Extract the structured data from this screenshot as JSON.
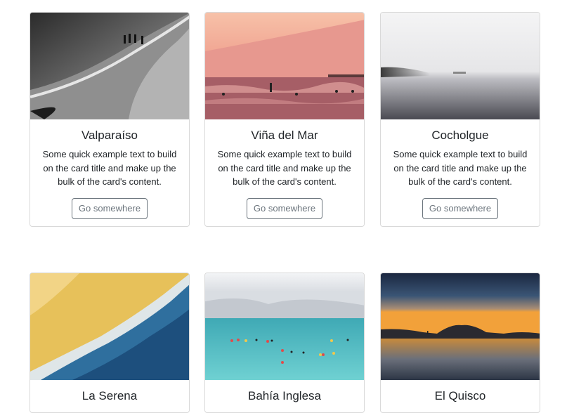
{
  "cards": [
    {
      "title": "Valparaíso",
      "text": "Some quick example text to build on the card title and make up the bulk of the card's content.",
      "button": "Go somewhere",
      "image": "aerial-beach-bw"
    },
    {
      "title": "Viña del Mar",
      "text": "Some quick example text to build on the card title and make up the bulk of the card's content.",
      "button": "Go somewhere",
      "image": "pink-surf-beach"
    },
    {
      "title": "Cocholgue",
      "text": "Some quick example text to build on the card title and make up the bulk of the card's content.",
      "button": "Go somewhere",
      "image": "misty-lake"
    },
    {
      "title": "La Serena",
      "image": "aerial-shoreline"
    },
    {
      "title": "Bahía Inglesa",
      "image": "turquoise-sea-swimmers"
    },
    {
      "title": "El Quisco",
      "image": "sunset-mountain-lake"
    }
  ]
}
